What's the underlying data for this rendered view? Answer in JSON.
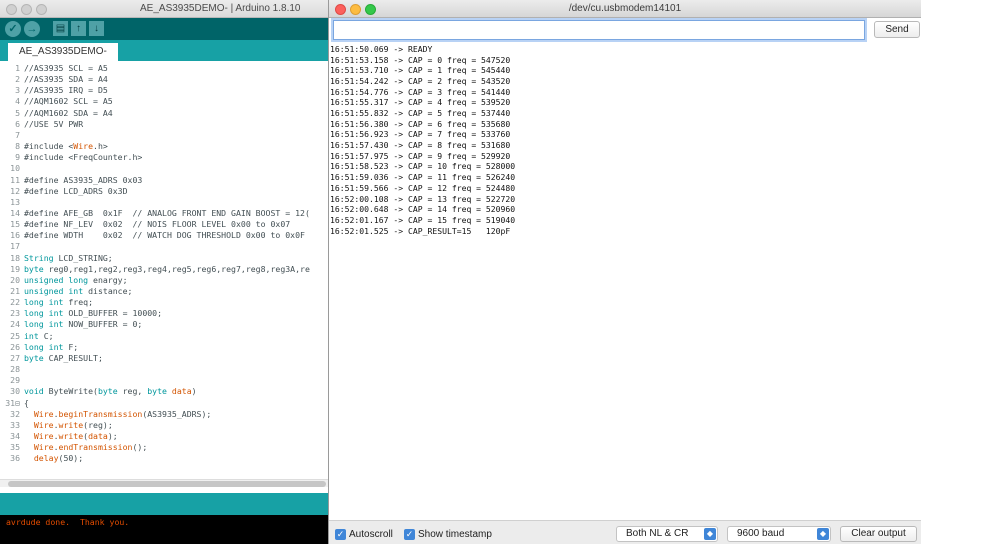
{
  "ide": {
    "title": "AE_AS3935DEMO- | Arduino 1.8.10",
    "tab": "AE_AS3935DEMO-",
    "code": [
      {
        "n": "1",
        "parts": [
          [
            "//AS3935 SCL = A5",
            "cm"
          ]
        ]
      },
      {
        "n": "2",
        "parts": [
          [
            "//AS3935 SDA = A4",
            "cm"
          ]
        ]
      },
      {
        "n": "3",
        "parts": [
          [
            "//AS3935 IRQ = D5",
            "cm"
          ]
        ]
      },
      {
        "n": "4",
        "parts": [
          [
            "//AQM1602 SCL = A5",
            "cm"
          ]
        ]
      },
      {
        "n": "5",
        "parts": [
          [
            "//AQM1602 SDA = A4",
            "cm"
          ]
        ]
      },
      {
        "n": "6",
        "parts": [
          [
            "//USE 5V PWR",
            "cm"
          ]
        ]
      },
      {
        "n": "7",
        "parts": []
      },
      {
        "n": "8",
        "parts": [
          [
            "#include <",
            ""
          ],
          [
            "Wire",
            "fn"
          ],
          [
            ".h>",
            ""
          ]
        ]
      },
      {
        "n": "9",
        "parts": [
          [
            "#include <FreqCounter.h>",
            ""
          ]
        ]
      },
      {
        "n": "10",
        "parts": []
      },
      {
        "n": "11",
        "parts": [
          [
            "#define AS3935_ADRS 0x03",
            ""
          ]
        ]
      },
      {
        "n": "12",
        "parts": [
          [
            "#define LCD_ADRS 0x3D",
            ""
          ]
        ]
      },
      {
        "n": "13",
        "parts": []
      },
      {
        "n": "14",
        "parts": [
          [
            "#define AFE_GB  0x1F  // ANALOG FRONT END GAIN BOOST = 12(",
            ""
          ]
        ]
      },
      {
        "n": "15",
        "parts": [
          [
            "#define NF_LEV  0x02  // NOIS FLOOR LEVEL 0x00 to 0x07",
            ""
          ]
        ]
      },
      {
        "n": "16",
        "parts": [
          [
            "#define WDTH    0x02  // WATCH DOG THRESHOLD 0x00 to 0x0F",
            ""
          ]
        ]
      },
      {
        "n": "17",
        "parts": []
      },
      {
        "n": "18",
        "parts": [
          [
            "String",
            "kw"
          ],
          [
            " LCD_STRING;",
            ""
          ]
        ]
      },
      {
        "n": "19",
        "parts": [
          [
            "byte",
            "kw"
          ],
          [
            " reg0,reg1,reg2,reg3,reg4,reg5,reg6,reg7,reg8,reg3A,re",
            ""
          ]
        ]
      },
      {
        "n": "20",
        "parts": [
          [
            "unsigned",
            "kw"
          ],
          [
            " ",
            ""
          ],
          [
            "long",
            "kw"
          ],
          [
            " enargy;",
            ""
          ]
        ]
      },
      {
        "n": "21",
        "parts": [
          [
            "unsigned",
            "kw"
          ],
          [
            " ",
            ""
          ],
          [
            "int",
            "kw"
          ],
          [
            " distance;",
            ""
          ]
        ]
      },
      {
        "n": "22",
        "parts": [
          [
            "long",
            "kw"
          ],
          [
            " ",
            ""
          ],
          [
            "int",
            "kw"
          ],
          [
            " freq;",
            ""
          ]
        ]
      },
      {
        "n": "23",
        "parts": [
          [
            "long",
            "kw"
          ],
          [
            " ",
            ""
          ],
          [
            "int",
            "kw"
          ],
          [
            " OLD_BUFFER = 10000;",
            ""
          ]
        ]
      },
      {
        "n": "24",
        "parts": [
          [
            "long",
            "kw"
          ],
          [
            " ",
            ""
          ],
          [
            "int",
            "kw"
          ],
          [
            " NOW_BUFFER = 0;",
            ""
          ]
        ]
      },
      {
        "n": "25",
        "parts": [
          [
            "int",
            "kw"
          ],
          [
            " C;",
            ""
          ]
        ]
      },
      {
        "n": "26",
        "parts": [
          [
            "long",
            "kw"
          ],
          [
            " ",
            ""
          ],
          [
            "int",
            "kw"
          ],
          [
            " F;",
            ""
          ]
        ]
      },
      {
        "n": "27",
        "parts": [
          [
            "byte",
            "kw"
          ],
          [
            " CAP_RESULT;",
            ""
          ]
        ]
      },
      {
        "n": "28",
        "parts": []
      },
      {
        "n": "29",
        "parts": []
      },
      {
        "n": "30",
        "parts": [
          [
            "void",
            "kw"
          ],
          [
            " ByteWrite(",
            ""
          ],
          [
            "byte",
            "kw"
          ],
          [
            " reg, ",
            ""
          ],
          [
            "byte",
            "kw"
          ],
          [
            " ",
            ""
          ],
          [
            "data",
            "fn"
          ],
          [
            ")",
            ""
          ]
        ]
      },
      {
        "n": "31⊟",
        "parts": [
          [
            "{",
            ""
          ]
        ]
      },
      {
        "n": "32",
        "parts": [
          [
            "  ",
            ""
          ],
          [
            "Wire",
            "fn"
          ],
          [
            ".",
            ""
          ],
          [
            "beginTransmission",
            "fn"
          ],
          [
            "(AS3935_ADRS);",
            ""
          ]
        ]
      },
      {
        "n": "33",
        "parts": [
          [
            "  ",
            ""
          ],
          [
            "Wire",
            "fn"
          ],
          [
            ".",
            ""
          ],
          [
            "write",
            "fn"
          ],
          [
            "(reg);",
            ""
          ]
        ]
      },
      {
        "n": "34",
        "parts": [
          [
            "  ",
            ""
          ],
          [
            "Wire",
            "fn"
          ],
          [
            ".",
            ""
          ],
          [
            "write",
            "fn"
          ],
          [
            "(",
            ""
          ],
          [
            "data",
            "fn"
          ],
          [
            ");",
            ""
          ]
        ]
      },
      {
        "n": "35",
        "parts": [
          [
            "  ",
            ""
          ],
          [
            "Wire",
            "fn"
          ],
          [
            ".",
            ""
          ],
          [
            "endTransmission",
            "fn"
          ],
          [
            "();",
            ""
          ]
        ]
      },
      {
        "n": "36",
        "parts": [
          [
            "  ",
            ""
          ],
          [
            "delay",
            "fn"
          ],
          [
            "(50);",
            ""
          ]
        ]
      }
    ],
    "console": "avrdude done.  Thank you."
  },
  "serial": {
    "title": "/dev/cu.usbmodem14101",
    "input_value": "",
    "send_label": "Send",
    "lines": [
      "16:51:50.069 -> READY",
      "16:51:53.158 -> CAP = 0 freq = 547520",
      "16:51:53.710 -> CAP = 1 freq = 545440",
      "16:51:54.242 -> CAP = 2 freq = 543520",
      "16:51:54.776 -> CAP = 3 freq = 541440",
      "16:51:55.317 -> CAP = 4 freq = 539520",
      "16:51:55.832 -> CAP = 5 freq = 537440",
      "16:51:56.380 -> CAP = 6 freq = 535680",
      "16:51:56.923 -> CAP = 7 freq = 533760",
      "16:51:57.430 -> CAP = 8 freq = 531680",
      "16:51:57.975 -> CAP = 9 freq = 529920",
      "16:51:58.523 -> CAP = 10 freq = 528000",
      "16:51:59.036 -> CAP = 11 freq = 526240",
      "16:51:59.566 -> CAP = 12 freq = 524480",
      "16:52:00.108 -> CAP = 13 freq = 522720",
      "16:52:00.648 -> CAP = 14 freq = 520960",
      "16:52:01.167 -> CAP = 15 freq = 519040",
      "16:52:01.525 -> CAP_RESULT=15   120pF"
    ],
    "autoscroll_label": "Autoscroll",
    "autoscroll_checked": true,
    "timestamp_label": "Show timestamp",
    "timestamp_checked": true,
    "line_ending": "Both NL & CR",
    "baud": "9600 baud",
    "clear_label": "Clear output"
  },
  "colors": {
    "arduino_dark": "#006468",
    "arduino_teal": "#17a1a5",
    "console_text": "#e34c00",
    "keyword": "#00979c",
    "function": "#d35400",
    "mac_blue": "#3f86d8"
  }
}
